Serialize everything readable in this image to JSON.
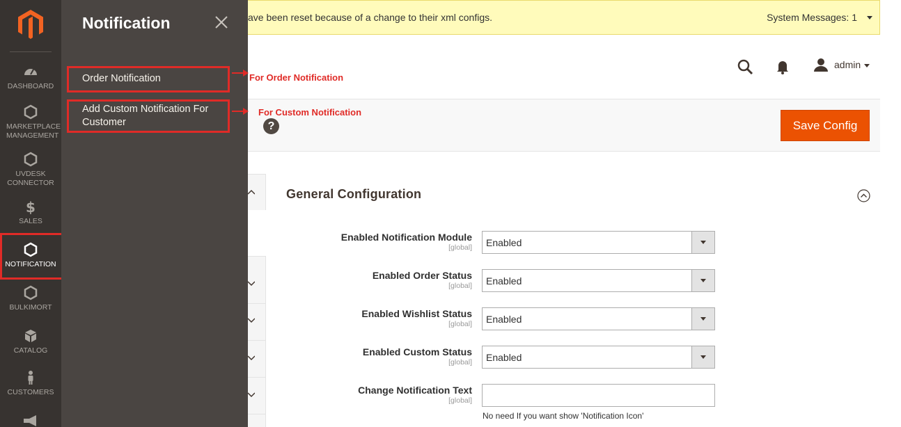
{
  "sidebar": {
    "logo": "magento-logo",
    "items": [
      {
        "label": "DASHBOARD",
        "icon": "dashboard-icon"
      },
      {
        "label": "MARKETPLACE MANAGEMENT",
        "icon": "hexagon-icon"
      },
      {
        "label": "UVDESK CONNECTOR",
        "icon": "hexagon-icon"
      },
      {
        "label": "SALES",
        "icon": "dollar-icon"
      },
      {
        "label": "NOTIFICATION",
        "icon": "hexagon-icon",
        "active": true
      },
      {
        "label": "BULKIMORT",
        "icon": "hexagon-icon"
      },
      {
        "label": "CATALOG",
        "icon": "cube-icon"
      },
      {
        "label": "CUSTOMERS",
        "icon": "person-icon"
      }
    ]
  },
  "flyout": {
    "title": "Notification",
    "links": [
      {
        "label": "Order Notification"
      },
      {
        "label": "Add Custom Notification For Customer"
      }
    ]
  },
  "system_message": {
    "text": "ave been reset because of a change to their xml configs.",
    "count_label": "System Messages: 1"
  },
  "header": {
    "user": "admin"
  },
  "actions": {
    "save_label": "Save Config"
  },
  "annotations": {
    "order": "For Order Notification",
    "custom": "For Custom Notification"
  },
  "section": {
    "title": "General Configuration",
    "fields": [
      {
        "label": "Enabled Notification Module",
        "scope": "[global]",
        "value": "Enabled"
      },
      {
        "label": "Enabled Order Status",
        "scope": "[global]",
        "value": "Enabled"
      },
      {
        "label": "Enabled Wishlist Status",
        "scope": "[global]",
        "value": "Enabled"
      },
      {
        "label": "Enabled Custom Status",
        "scope": "[global]",
        "value": "Enabled"
      },
      {
        "label": "Change Notification Text",
        "scope": "[global]",
        "value": "",
        "note": "No need If you want show 'Notification Icon'"
      }
    ]
  },
  "colors": {
    "sidebar_bg": "#373330",
    "flyout_bg": "#4a4542",
    "accent": "#eb5202",
    "annotation": "#e02b27",
    "system_bar": "#fffbbb"
  }
}
